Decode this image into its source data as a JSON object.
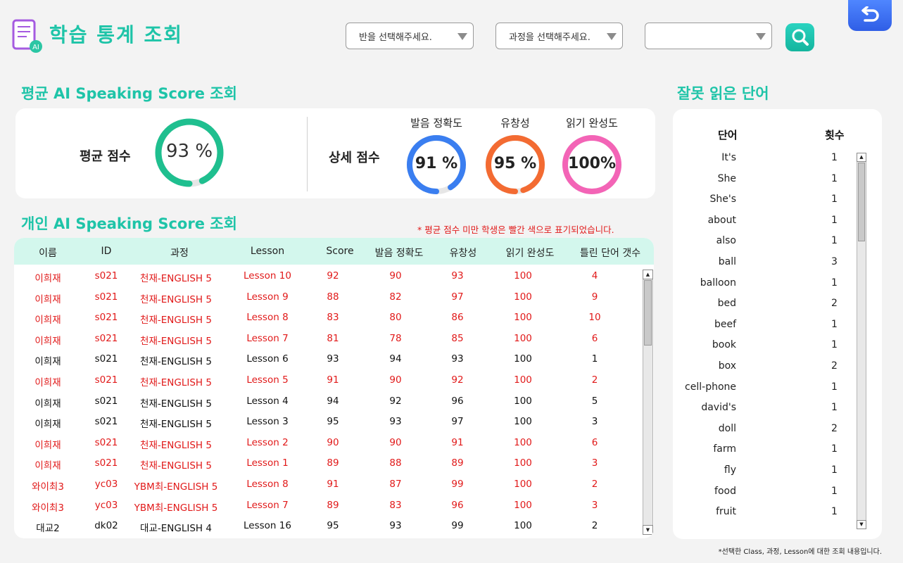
{
  "header": {
    "title": "학습 통계 조회",
    "logo_badge": "AI",
    "class_select": {
      "placeholder": "반을 선택해주세요."
    },
    "course_select": {
      "placeholder": "과정을 선택해주세요."
    },
    "lesson_select": {
      "placeholder": ""
    },
    "search_icon": "search-icon",
    "back_icon": "undo-arrow-icon"
  },
  "average": {
    "section_title": "평균 AI Speaking Score 조회",
    "avg_label": "평균 점수",
    "avg_value": "93 %",
    "avg_percent": 93,
    "avg_color": "#1fbf8f",
    "detail_label": "상세 점수",
    "details": [
      {
        "label": "발음 정확도",
        "value": "91 %",
        "percent": 91,
        "color": "#3a7ef0"
      },
      {
        "label": "유창성",
        "value": "95 %",
        "percent": 95,
        "color": "#f36b32"
      },
      {
        "label": "읽기 완성도",
        "value": "100%",
        "percent": 100,
        "color": "#f364b6"
      }
    ]
  },
  "personal": {
    "section_title": "개인 AI Speaking Score 조회",
    "note": "* 평균 점수 미만 학생은 빨간 색으로 표기되었습니다.",
    "columns": [
      "이름",
      "ID",
      "과정",
      "Lesson",
      "Score",
      "발음 정확도",
      "유창성",
      "읽기 완성도",
      "틀린 단어 갯수"
    ],
    "rows": [
      {
        "name": "이희재",
        "id": "s021",
        "course": "천재-ENGLISH 5",
        "lesson": "Lesson 10",
        "score": "92",
        "pron": "90",
        "fluency": "93",
        "complete": "100",
        "wrong": "4",
        "below_avg": true
      },
      {
        "name": "이희재",
        "id": "s021",
        "course": "천재-ENGLISH 5",
        "lesson": "Lesson 9",
        "score": "88",
        "pron": "82",
        "fluency": "97",
        "complete": "100",
        "wrong": "9",
        "below_avg": true
      },
      {
        "name": "이희재",
        "id": "s021",
        "course": "천재-ENGLISH 5",
        "lesson": "Lesson 8",
        "score": "83",
        "pron": "80",
        "fluency": "86",
        "complete": "100",
        "wrong": "10",
        "below_avg": true
      },
      {
        "name": "이희재",
        "id": "s021",
        "course": "천재-ENGLISH 5",
        "lesson": "Lesson 7",
        "score": "81",
        "pron": "78",
        "fluency": "85",
        "complete": "100",
        "wrong": "6",
        "below_avg": true
      },
      {
        "name": "이희재",
        "id": "s021",
        "course": "천재-ENGLISH 5",
        "lesson": "Lesson 6",
        "score": "93",
        "pron": "94",
        "fluency": "93",
        "complete": "100",
        "wrong": "1",
        "below_avg": false
      },
      {
        "name": "이희재",
        "id": "s021",
        "course": "천재-ENGLISH 5",
        "lesson": "Lesson 5",
        "score": "91",
        "pron": "90",
        "fluency": "92",
        "complete": "100",
        "wrong": "2",
        "below_avg": true
      },
      {
        "name": "이희재",
        "id": "s021",
        "course": "천재-ENGLISH 5",
        "lesson": "Lesson 4",
        "score": "94",
        "pron": "92",
        "fluency": "96",
        "complete": "100",
        "wrong": "5",
        "below_avg": false
      },
      {
        "name": "이희재",
        "id": "s021",
        "course": "천재-ENGLISH 5",
        "lesson": "Lesson 3",
        "score": "95",
        "pron": "93",
        "fluency": "97",
        "complete": "100",
        "wrong": "3",
        "below_avg": false
      },
      {
        "name": "이희재",
        "id": "s021",
        "course": "천재-ENGLISH 5",
        "lesson": "Lesson 2",
        "score": "90",
        "pron": "90",
        "fluency": "91",
        "complete": "100",
        "wrong": "6",
        "below_avg": true
      },
      {
        "name": "이희재",
        "id": "s021",
        "course": "천재-ENGLISH 5",
        "lesson": "Lesson 1",
        "score": "89",
        "pron": "88",
        "fluency": "89",
        "complete": "100",
        "wrong": "3",
        "below_avg": true
      },
      {
        "name": "와이최3",
        "id": "yc03",
        "course": "YBM최-ENGLISH 5",
        "lesson": "Lesson 8",
        "score": "91",
        "pron": "87",
        "fluency": "99",
        "complete": "100",
        "wrong": "2",
        "below_avg": true
      },
      {
        "name": "와이최3",
        "id": "yc03",
        "course": "YBM최-ENGLISH 5",
        "lesson": "Lesson 7",
        "score": "89",
        "pron": "83",
        "fluency": "96",
        "complete": "100",
        "wrong": "3",
        "below_avg": true
      },
      {
        "name": "대교2",
        "id": "dk02",
        "course": "대교-ENGLISH 4",
        "lesson": "Lesson 16",
        "score": "95",
        "pron": "93",
        "fluency": "99",
        "complete": "100",
        "wrong": "2",
        "below_avg": false
      }
    ],
    "below_color": "#e11919"
  },
  "words": {
    "section_title": "잘못 읽은 단어",
    "col_word": "단어",
    "col_count": "횟수",
    "items": [
      {
        "word": "It's",
        "count": "1"
      },
      {
        "word": "She",
        "count": "1"
      },
      {
        "word": "She's",
        "count": "1"
      },
      {
        "word": "about",
        "count": "1"
      },
      {
        "word": "also",
        "count": "1"
      },
      {
        "word": "ball",
        "count": "3"
      },
      {
        "word": "balloon",
        "count": "1"
      },
      {
        "word": "bed",
        "count": "2"
      },
      {
        "word": "beef",
        "count": "1"
      },
      {
        "word": "book",
        "count": "1"
      },
      {
        "word": "box",
        "count": "2"
      },
      {
        "word": "cell-phone",
        "count": "1"
      },
      {
        "word": "david's",
        "count": "1"
      },
      {
        "word": "doll",
        "count": "2"
      },
      {
        "word": "farm",
        "count": "1"
      },
      {
        "word": "fly",
        "count": "1"
      },
      {
        "word": "food",
        "count": "1"
      },
      {
        "word": "fruit",
        "count": "1"
      }
    ]
  },
  "footnote": "*선택한 Class, 과정, Lesson에 대한 조회 내용입니다."
}
